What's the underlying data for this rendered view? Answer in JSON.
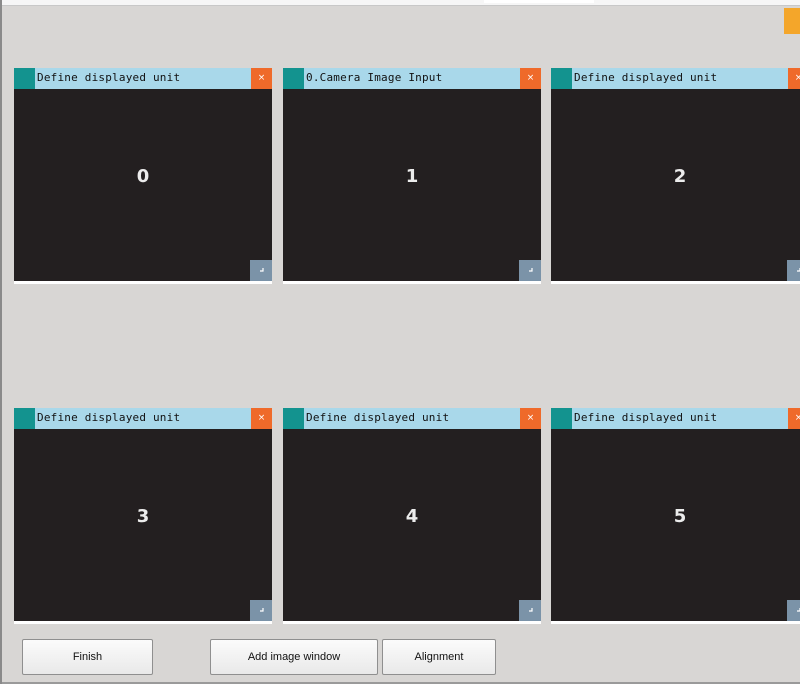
{
  "windows": [
    {
      "title": "Define displayed unit",
      "number": "0",
      "close_icon": "×"
    },
    {
      "title": "0.Camera Image Input",
      "number": "1",
      "close_icon": "×"
    },
    {
      "title": "Define displayed unit",
      "number": "2",
      "close_icon": "×"
    },
    {
      "title": "Define displayed unit",
      "number": "3",
      "close_icon": "×"
    },
    {
      "title": "Define displayed unit",
      "number": "4",
      "close_icon": "×"
    },
    {
      "title": "Define displayed unit",
      "number": "5",
      "close_icon": "×"
    }
  ],
  "buttons": {
    "finish": "Finish",
    "add_image_window": "Add image window",
    "alignment": "Alignment"
  },
  "colors": {
    "window_title_bg": "#a9d8ea",
    "window_tab": "#13938f",
    "close_button": "#ef6a2a",
    "image_bg": "#231f20",
    "resize_handle": "#7b93a8",
    "accent_orange": "#f4a62a"
  },
  "icons": {
    "close": "close-icon",
    "resize": "resize-corner-icon"
  }
}
